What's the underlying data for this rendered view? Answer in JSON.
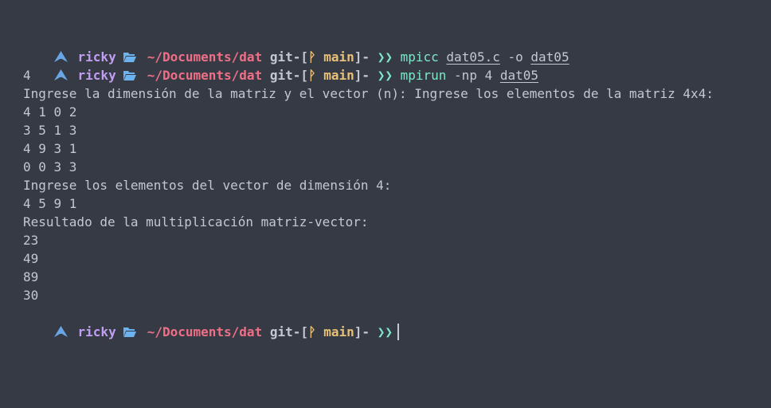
{
  "prompt": {
    "user": "ricky",
    "path": "~/Documents/dat",
    "git_prefix": "git-[",
    "branch_icon": "ᚹ",
    "branch": "main",
    "git_suffix": "]-",
    "chevron": "❯❯"
  },
  "commands": [
    {
      "program": "mpicc",
      "args": [
        {
          "text": "dat05.c",
          "underline": true
        },
        {
          "text": "-o",
          "underline": false
        },
        {
          "text": "dat05",
          "underline": true
        }
      ]
    },
    {
      "program": "mpirun",
      "args": [
        {
          "text": "-np",
          "underline": false
        },
        {
          "text": "4",
          "underline": false
        },
        {
          "text": "dat05",
          "underline": true
        }
      ]
    }
  ],
  "output": [
    "4",
    "Ingrese la dimensión de la matriz y el vector (n): Ingrese los elementos de la matriz 4x4:",
    "4 1 0 2",
    "3 5 1 3",
    "4 9 3 1",
    "0 0 3 3",
    "Ingrese los elementos del vector de dimensión 4:",
    "4 5 9 1",
    "Resultado de la multiplicación matriz-vector:",
    "23",
    "49",
    "89",
    "30"
  ],
  "colors": {
    "background": "#363a45",
    "text": "#c2c8d2",
    "user": "#c19ef2",
    "path": "#ee6f86",
    "branch": "#e8c078",
    "accent": "#7ee8c9",
    "arch_icon": "#69a6e6",
    "folder_icon": "#6cb2ee"
  },
  "icons": {
    "distro": "arch-linux-icon",
    "folder": "folder-open-icon"
  }
}
